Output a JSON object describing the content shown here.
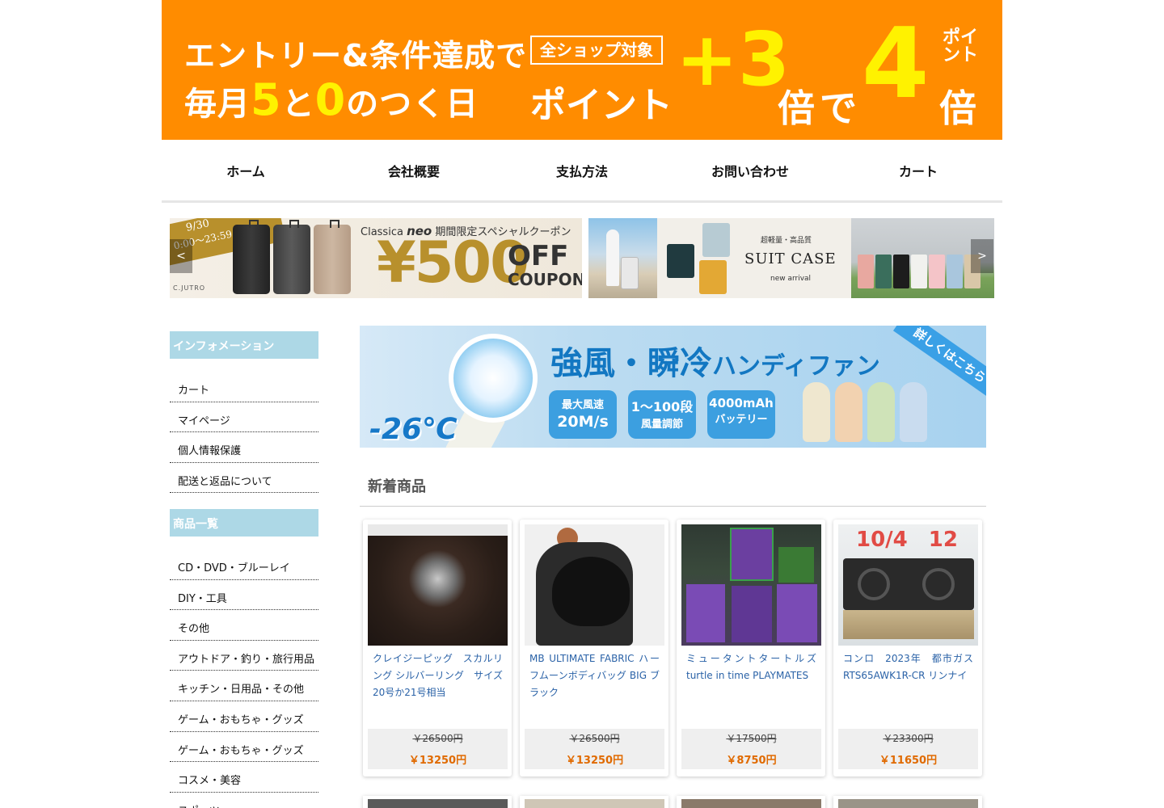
{
  "campaign": {
    "line1": "エントリー&条件達成で",
    "line2_a": "毎月",
    "line2_five": "5",
    "line2_to": "と",
    "line2_zero": "0",
    "line2_b": "のつく日",
    "allshop": "全ショップ対象",
    "point": "ポイント",
    "plus3": "+3",
    "bai": "倍",
    "de": "で",
    "four": "4",
    "point_vertical": "ポイント",
    "bai2": "倍"
  },
  "nav": [
    "ホーム",
    "会社概要",
    "支払方法",
    "お問い合わせ",
    "カート"
  ],
  "slider": {
    "slide1": {
      "date": "9/30",
      "time": "0:00～23:59",
      "brand": "C.JUTRO",
      "promo_brand": "Classica",
      "promo_brand2": "neo",
      "promo_text": "期間限定スペシャルクーポン",
      "amount": "¥500",
      "off": "OFF",
      "coupon": "COUPON"
    },
    "slide2": {
      "caption1": "超軽量・高品質",
      "caption2": "SUIT CASE",
      "caption3": "new arrival"
    },
    "prev": "<",
    "next": ">"
  },
  "sidebar": {
    "info_title": "インフォメーション",
    "info_items": [
      "カート",
      "マイページ",
      "個人情報保護",
      "配送と返品について"
    ],
    "cat_title": "商品一覧",
    "cat_items": [
      "CD・DVD・ブルーレイ",
      "DIY・工具",
      "その他",
      "アウトドア・釣り・旅行用品",
      "キッチン・日用品・その他",
      "ゲーム・おもちゃ・グッズ",
      "ゲーム・おもちゃ・グッズ",
      "コスメ・美容",
      "スポーツ"
    ]
  },
  "fan_banner": {
    "headline": "強風・瞬冷",
    "headline_small": "ハンディファン",
    "temp": "-26℃",
    "badge1_small": "最大風速",
    "badge1_large": "20M/s",
    "badge2_small": "1～100段",
    "badge2_large": "風量調節",
    "badge3_small": "4000mAh",
    "badge3_large": "バッテリー",
    "corner": "詳しくはこちら",
    "colors": {
      "cream": "#efe7cf",
      "orange": "#f2d2b0",
      "green": "#cfe3b8",
      "blue": "#c9dcef"
    }
  },
  "new_section": {
    "title": "新着商品",
    "products": [
      {
        "name": "クレイジーピッグ　スカルリング シルバーリング　サイズ20号か21号相当",
        "old_price": "￥26500円",
        "price": "￥13250円"
      },
      {
        "name": "MB ULTIMATE FABRIC ハーフムーンボディバッグ BIG ブラック",
        "old_price": "￥26500円",
        "price": "￥13250円"
      },
      {
        "name": "ミュータントタートルズ turtle in time PLAYMATES",
        "old_price": "￥17500円",
        "price": "￥8750円"
      },
      {
        "name": "コンロ　2023年　都市ガス RTS65AWK1R-CR リンナイ",
        "old_price": "￥23300円",
        "price": "￥11650円",
        "img_text": "10/4　12"
      }
    ]
  },
  "colors": {
    "campaign_bg": "#ff8c00",
    "campaign_accent": "#fff200",
    "sidebar_head": "#add8e6",
    "link": "#2a62a7",
    "price": "#e06a00"
  }
}
